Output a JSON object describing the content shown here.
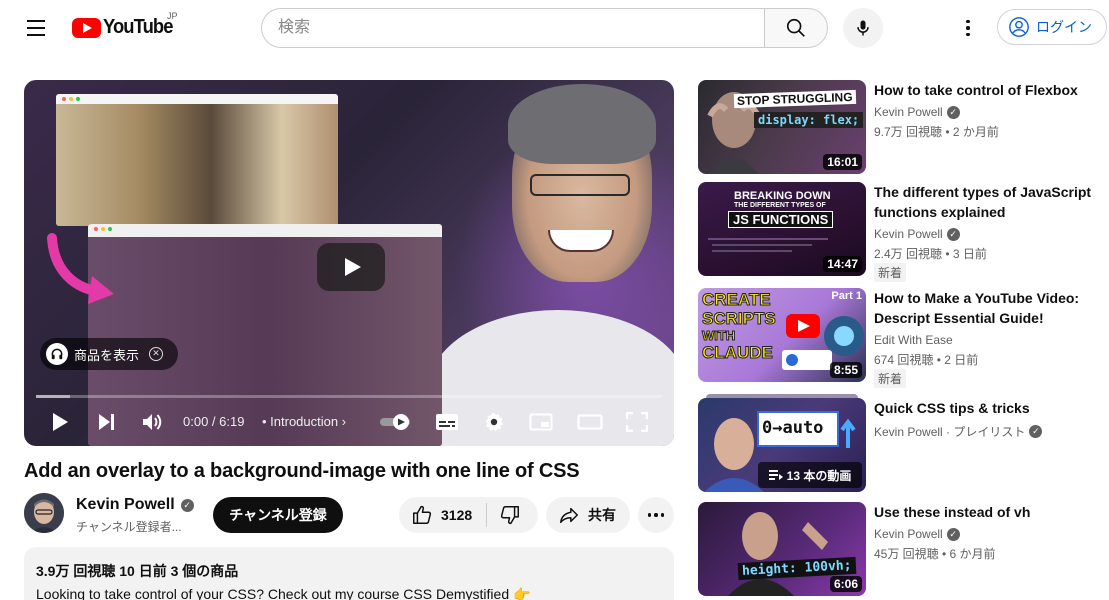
{
  "header": {
    "logo_text": "YouTube",
    "region": "JP",
    "search_placeholder": "検索",
    "login_label": "ログイン"
  },
  "player": {
    "time_current": "0:00",
    "time_total": "6:19",
    "time_display": "0:00 / 6:19",
    "chapter": "Introduction",
    "product_chip": "商品を表示"
  },
  "video": {
    "title": "Add an overlay to a background-image with one line of CSS",
    "channel_name": "Kevin Powell",
    "subscribers": "チャンネル登録者...",
    "subscribe_label": "チャンネル登録",
    "likes": "3128",
    "share_label": "共有",
    "description": {
      "meta": "3.9万 回視聴  10 日前  3 個の商品",
      "text": "Looking to take control of your CSS? Check out my course CSS Demystified 👉"
    }
  },
  "sidebar": {
    "items": [
      {
        "title": "How to take control of Flexbox",
        "channel": "Kevin Powell",
        "meta": "9.7万 回視聴 • 2 か月前",
        "duration": "16:01",
        "thumb_line1": "STOP STRUGGLING",
        "thumb_line2": "display: flex;"
      },
      {
        "title": "The different types of JavaScript functions explained",
        "channel": "Kevin Powell",
        "meta": "2.4万 回視聴 • 3 日前",
        "badge": "新着",
        "duration": "14:47",
        "thumb_line1": "BREAKING DOWN",
        "thumb_line2": "THE DIFFERENT TYPES OF",
        "thumb_line3": "JS FUNCTIONS"
      },
      {
        "title": "How to Make a YouTube Video: Descript Essential Guide!",
        "channel": "Edit With Ease",
        "meta": "674 回視聴 • 2 日前",
        "badge": "新着",
        "duration": "8:55",
        "thumb_line1": "CREATE",
        "thumb_line2": "SCRIPTS",
        "thumb_line3": "WITH",
        "thumb_line4": "CLAUDE",
        "thumb_part": "Part 1"
      },
      {
        "title": "Quick CSS tips & tricks",
        "channel": "Kevin Powell · プレイリスト",
        "playlist_count": "13 本の動画",
        "thumb_line1": "0→auto"
      },
      {
        "title": "Use these instead of vh",
        "channel": "Kevin Powell",
        "meta": "45万 回視聴 • 6 か月前",
        "duration": "6:06",
        "thumb_line1": "height: 100vh;"
      }
    ]
  }
}
